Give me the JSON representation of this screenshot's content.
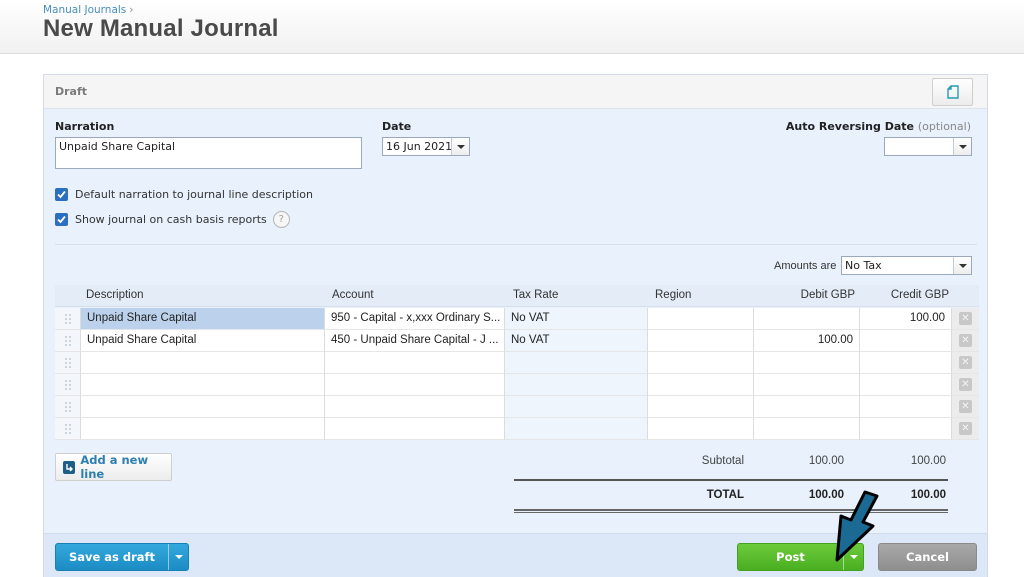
{
  "header": {
    "breadcrumb": "Manual Journals",
    "breadcrumb_sep": "›",
    "title": "New Manual Journal"
  },
  "panel": {
    "status": "Draft",
    "doc_button_icon": "document-icon"
  },
  "form": {
    "narration_label": "Narration",
    "narration_value": "Unpaid Share Capital",
    "date_label": "Date",
    "date_value": "16 Jun 2021",
    "auto_reversing_label": "Auto Reversing Date",
    "auto_reversing_optional": "(optional)",
    "auto_reversing_value": "",
    "checkbox_default_narration": {
      "label": "Default narration to journal line description",
      "checked": true
    },
    "checkbox_cash_basis": {
      "label": "Show journal on cash basis reports",
      "checked": true
    },
    "help_icon": "?",
    "amounts_are_label": "Amounts are",
    "amounts_are_value": "No Tax"
  },
  "table": {
    "columns": [
      "Description",
      "Account",
      "Tax Rate",
      "Region",
      "Debit GBP",
      "Credit GBP"
    ],
    "rows": [
      {
        "description": "Unpaid Share Capital",
        "account": "950 - Capital - x,xxx Ordinary S...",
        "tax_rate": "No VAT",
        "region": "",
        "debit": "",
        "credit": "100.00"
      },
      {
        "description": "Unpaid Share Capital",
        "account": "450 - Unpaid Share Capital - J ...",
        "tax_rate": "No VAT",
        "region": "",
        "debit": "100.00",
        "credit": ""
      },
      {
        "description": "",
        "account": "",
        "tax_rate": "",
        "region": "",
        "debit": "",
        "credit": ""
      },
      {
        "description": "",
        "account": "",
        "tax_rate": "",
        "region": "",
        "debit": "",
        "credit": ""
      },
      {
        "description": "",
        "account": "",
        "tax_rate": "",
        "region": "",
        "debit": "",
        "credit": ""
      },
      {
        "description": "",
        "account": "",
        "tax_rate": "",
        "region": "",
        "debit": "",
        "credit": ""
      }
    ],
    "delete_glyph": "✕"
  },
  "add_line_label": "Add a new line",
  "totals": {
    "subtotal_label": "Subtotal",
    "subtotal_debit": "100.00",
    "subtotal_credit": "100.00",
    "total_label": "TOTAL",
    "total_debit": "100.00",
    "total_credit": "100.00"
  },
  "footer": {
    "save_draft_label": "Save as draft",
    "post_label": "Post",
    "cancel_label": "Cancel"
  },
  "colors": {
    "accent_blue": "#1c8cc4",
    "post_green": "#4aae22",
    "cancel_gray": "#8e8e8e",
    "annotation_arrow": "#1b6a94"
  }
}
